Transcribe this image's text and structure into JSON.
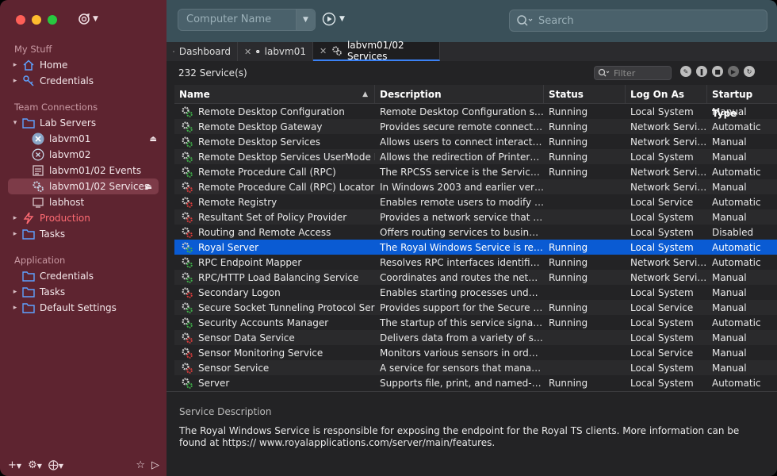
{
  "sidebar": {
    "sections": {
      "my_stuff": "My Stuff",
      "team": "Team Connections",
      "application": "Application"
    },
    "my_stuff_items": [
      {
        "label": "Home",
        "icon": "home-icon"
      },
      {
        "label": "Credentials",
        "icon": "key-icon"
      }
    ],
    "team_items": [
      {
        "label": "Lab Servers",
        "icon": "folder-icon"
      },
      {
        "label": "labvm01",
        "icon": "royal-connection-icon"
      },
      {
        "label": "labvm02",
        "icon": "royal-connection-icon"
      },
      {
        "label": "labvm01/02 Events",
        "icon": "events-icon"
      },
      {
        "label": "labvm01/02 Services",
        "icon": "services-icon"
      },
      {
        "label": "labhost",
        "icon": "host-icon"
      },
      {
        "label": "Production",
        "icon": "lightning-folder-icon"
      },
      {
        "label": "Tasks",
        "icon": "folder-icon"
      }
    ],
    "application_items": [
      {
        "label": "Credentials",
        "icon": "folder-icon"
      },
      {
        "label": "Tasks",
        "icon": "folder-icon"
      },
      {
        "label": "Default Settings",
        "icon": "folder-icon"
      }
    ]
  },
  "toolbar": {
    "computer_name_placeholder": "Computer Name",
    "search_placeholder": "Search"
  },
  "tabs": [
    {
      "label": "Dashboard",
      "icon": "dashboard-icon"
    },
    {
      "label": "labvm01",
      "icon": "royal-connection-icon"
    },
    {
      "label": "labvm01/02 Services",
      "icon": "services-icon",
      "active": true
    }
  ],
  "services": {
    "count_label": "232 Service(s)",
    "filter_placeholder": "Filter",
    "columns": [
      "Name",
      "Description",
      "Status",
      "Log On As",
      "Startup Type"
    ],
    "rows": [
      {
        "name": "Remote Desktop Configuration",
        "desc": "Remote Desktop Configuration servic...",
        "status": "Running",
        "logon": "Local System",
        "startup": "Manual",
        "state": "running"
      },
      {
        "name": "Remote Desktop Gateway",
        "desc": "Provides secure remote connectivity...",
        "status": "Running",
        "logon": "Network Service",
        "startup": "Automatic",
        "state": "running"
      },
      {
        "name": "Remote Desktop Services",
        "desc": "Allows users to connect interactively...",
        "status": "Running",
        "logon": "Network Service",
        "startup": "Manual",
        "state": "running"
      },
      {
        "name": "Remote Desktop Services UserMode Por...",
        "desc": "Allows the redirection of Printers/Driv...",
        "status": "Running",
        "logon": "Local System",
        "startup": "Manual",
        "state": "running"
      },
      {
        "name": "Remote Procedure Call (RPC)",
        "desc": "The RPCSS service is the Service Co...",
        "status": "Running",
        "logon": "Network Service",
        "startup": "Automatic",
        "state": "running"
      },
      {
        "name": "Remote Procedure Call (RPC) Locator",
        "desc": "In Windows 2003 and earlier versions...",
        "status": "",
        "logon": "Network Service",
        "startup": "Manual",
        "state": "stopped"
      },
      {
        "name": "Remote Registry",
        "desc": "Enables remote users to modify regis...",
        "status": "",
        "logon": "Local Service",
        "startup": "Automatic",
        "state": "stopped"
      },
      {
        "name": "Resultant Set of Policy Provider",
        "desc": "Provides a network service that proc...",
        "status": "",
        "logon": "Local System",
        "startup": "Manual",
        "state": "stopped"
      },
      {
        "name": "Routing and Remote Access",
        "desc": "Offers routing services to businesses...",
        "status": "",
        "logon": "Local System",
        "startup": "Disabled",
        "state": "stopped"
      },
      {
        "name": "Royal Server",
        "desc": "The Royal Windows Service is respon...",
        "status": "Running",
        "logon": "Local System",
        "startup": "Automatic",
        "state": "running",
        "selected": true
      },
      {
        "name": "RPC Endpoint Mapper",
        "desc": "Resolves RPC interfaces identifiers to...",
        "status": "Running",
        "logon": "Network Service",
        "startup": "Automatic",
        "state": "running"
      },
      {
        "name": "RPC/HTTP Load Balancing Service",
        "desc": "Coordinates and routes the network t...",
        "status": "Running",
        "logon": "Network Service",
        "startup": "Manual",
        "state": "running"
      },
      {
        "name": "Secondary Logon",
        "desc": "Enables starting processes under alt...",
        "status": "",
        "logon": "Local System",
        "startup": "Manual",
        "state": "stopped"
      },
      {
        "name": "Secure Socket Tunneling Protocol Service",
        "desc": "Provides support for the Secure Sock...",
        "status": "Running",
        "logon": "Local Service",
        "startup": "Manual",
        "state": "running"
      },
      {
        "name": "Security Accounts Manager",
        "desc": "The startup of this service signals ot...",
        "status": "Running",
        "logon": "Local System",
        "startup": "Automatic",
        "state": "running"
      },
      {
        "name": "Sensor Data Service",
        "desc": "Delivers data from a variety of sensors",
        "status": "",
        "logon": "Local System",
        "startup": "Manual",
        "state": "stopped"
      },
      {
        "name": "Sensor Monitoring Service",
        "desc": "Monitors various sensors in order to...",
        "status": "",
        "logon": "Local Service",
        "startup": "Manual",
        "state": "stopped"
      },
      {
        "name": "Sensor Service",
        "desc": "A service for sensors that manages di...",
        "status": "",
        "logon": "Local System",
        "startup": "Manual",
        "state": "stopped"
      },
      {
        "name": "Server",
        "desc": "Supports file, print, and named-pipe...",
        "status": "Running",
        "logon": "Local System",
        "startup": "Automatic",
        "state": "running"
      }
    ]
  },
  "description_panel": {
    "title": "Service Description",
    "text": "The Royal Windows Service is responsible for exposing the endpoint for the Royal TS clients. More information can be found at https:// www.royalapplications.com/server/main/features."
  },
  "colors": {
    "sidebar_bg": "#5e2430",
    "toolbar_bg": "#3a5059",
    "selection": "#0a5bd3",
    "running_gear": "#3fae49",
    "stopped_gear": "#d93b3b",
    "production_red": "#ff6b73"
  }
}
